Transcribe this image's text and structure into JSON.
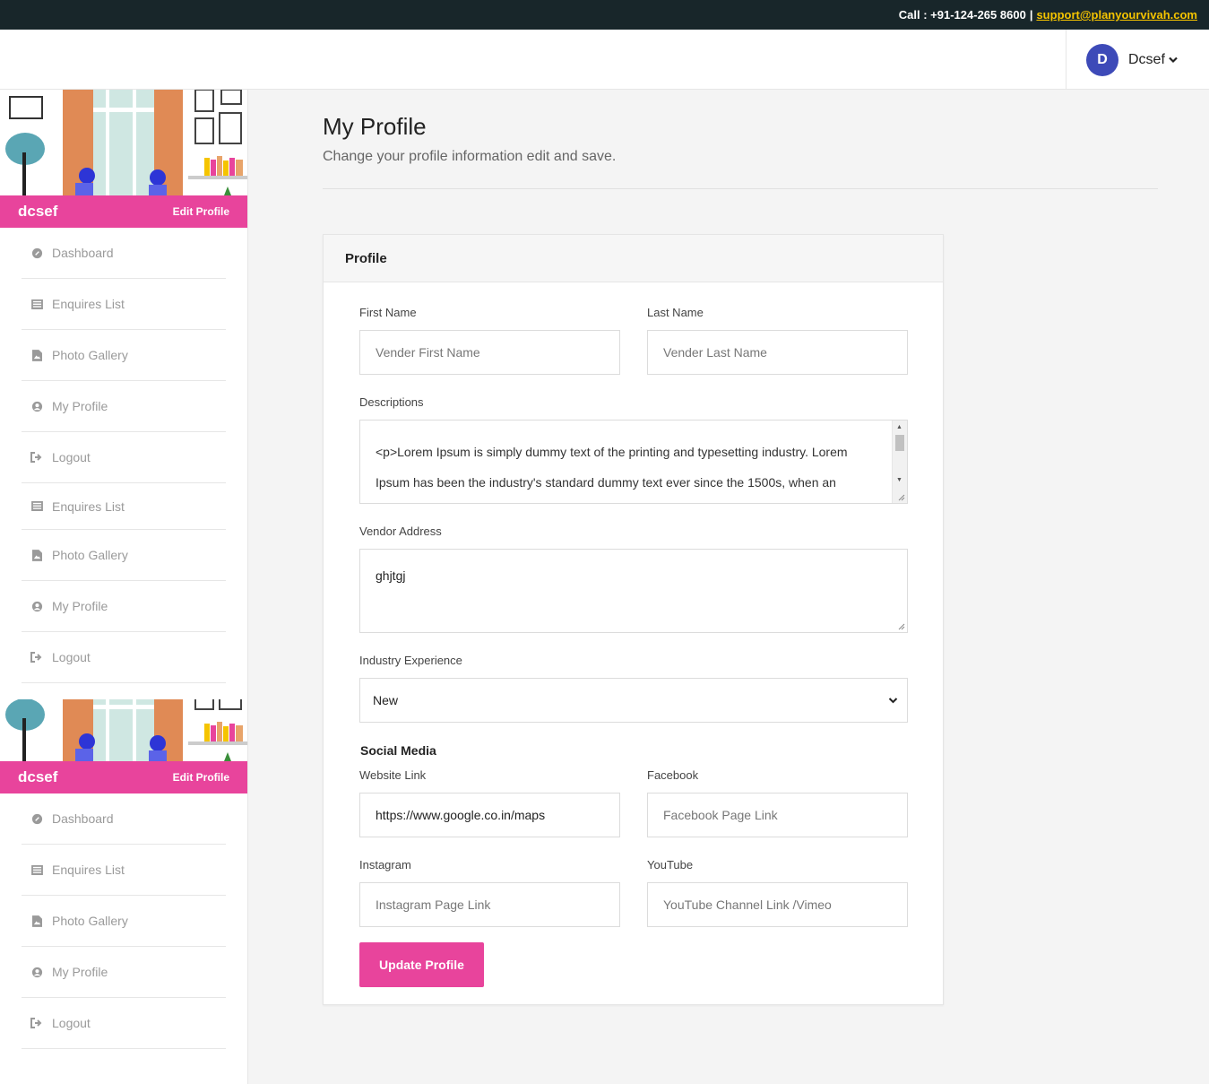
{
  "topbar": {
    "call_label": "Call : +91-124-265 8600",
    "separator": "|",
    "email": "support@planyourvivah.com"
  },
  "header": {
    "avatar_initial": "D",
    "user_name": "Dcsef"
  },
  "sidebar": {
    "user_name": "dcsef",
    "edit_profile": "Edit Profile",
    "nav_first": [
      {
        "label": "Dashboard",
        "icon": "dashboard-icon"
      },
      {
        "label": "Enquires List",
        "icon": "list-icon"
      },
      {
        "label": "Photo Gallery",
        "icon": "image-icon"
      },
      {
        "label": "My Profile",
        "icon": "user-icon"
      },
      {
        "label": "Logout",
        "icon": "logout-icon"
      },
      {
        "label": "Enquires List",
        "icon": "list-icon"
      },
      {
        "label": "Photo Gallery",
        "icon": "image-icon"
      },
      {
        "label": "My Profile",
        "icon": "user-icon"
      },
      {
        "label": "Logout",
        "icon": "logout-icon"
      }
    ],
    "nav_second": [
      {
        "label": "Dashboard",
        "icon": "dashboard-icon"
      },
      {
        "label": "Enquires List",
        "icon": "list-icon"
      },
      {
        "label": "Photo Gallery",
        "icon": "image-icon"
      },
      {
        "label": "My Profile",
        "icon": "user-icon"
      },
      {
        "label": "Logout",
        "icon": "logout-icon"
      }
    ]
  },
  "main": {
    "title": "My Profile",
    "subtitle": "Change your profile information edit and save.",
    "card_title": "Profile",
    "first_name": {
      "label": "First Name",
      "placeholder": "Vender First Name"
    },
    "last_name": {
      "label": "Last Name",
      "placeholder": "Vender Last Name"
    },
    "descriptions": {
      "label": "Descriptions",
      "line1": "<p>Lorem Ipsum is simply dummy text of the printing and typesetting industry. Lorem",
      "line2": "Ipsum has been the industry's standard dummy text ever since the 1500s, when an"
    },
    "address": {
      "label": "Vendor Address",
      "value": "ghjtgj"
    },
    "experience": {
      "label": "Industry Experience",
      "value": "New"
    },
    "social_heading": "Social Media",
    "website": {
      "label": "Website Link",
      "value": "https://www.google.co.in/maps"
    },
    "facebook": {
      "label": "Facebook",
      "placeholder": "Facebook Page Link"
    },
    "instagram": {
      "label": "Instagram",
      "placeholder": "Instagram Page Link"
    },
    "youtube": {
      "label": "YouTube",
      "placeholder": "YouTube Channel Link /Vimeo"
    },
    "submit": "Update Profile"
  },
  "colors": {
    "accent": "#e8449c",
    "topbar": "#18262a",
    "link": "#f5c400",
    "avatar": "#3d4ab8"
  }
}
